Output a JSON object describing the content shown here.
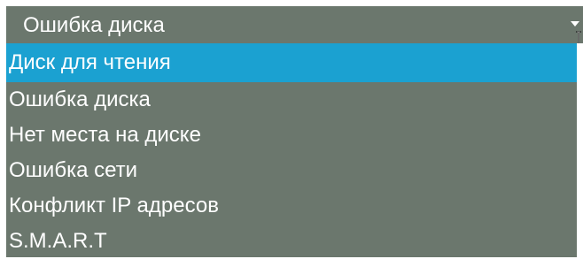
{
  "select": {
    "value": "Ошибка диска"
  },
  "options": [
    "Диск для чтения",
    "Ошибка диска",
    "Нет места на диске",
    "Ошибка сети",
    "Конфликт IP адресов",
    "S.M.A.R.T"
  ],
  "icons": {
    "dropdown": "chevron-down-icon",
    "cursor": "text-cursor-icon"
  },
  "colors": {
    "panel": "#6b776d",
    "highlight": "#1ba1d1",
    "text": "#ffffff"
  }
}
